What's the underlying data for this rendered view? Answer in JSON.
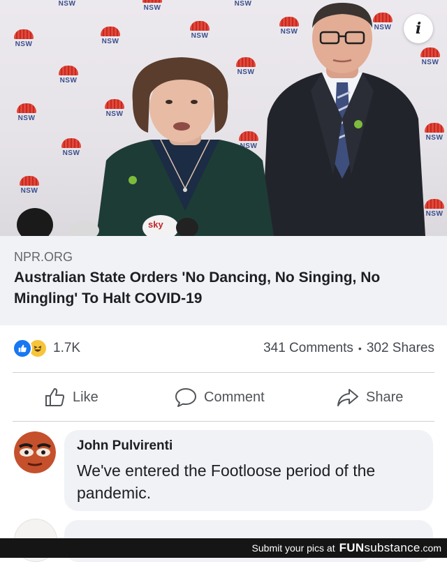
{
  "photo": {
    "logo_text": "NSW",
    "mic_label": "sky",
    "info_icon": "i"
  },
  "link_preview": {
    "domain": "NPR.ORG",
    "title": "Australian State Orders 'No Dancing, No Singing, No Mingling' To Halt COVID-19"
  },
  "reactions": {
    "icons": [
      "like-icon",
      "haha-icon"
    ],
    "count": "1.7K"
  },
  "stats": {
    "comments": "341 Comments",
    "separator": "•",
    "shares": "302 Shares"
  },
  "actions": {
    "like": "Like",
    "comment": "Comment",
    "share": "Share"
  },
  "comment": {
    "author": "John Pulvirenti",
    "text": "We've entered the Footloose period of the pandemic."
  },
  "watermark": {
    "prefix": "Submit your pics at",
    "brand_a": "FUN",
    "brand_b": "substance",
    "brand_c": ".com"
  },
  "colors": {
    "facebook_blue": "#1877f2",
    "haha_yellow": "#f7c53b",
    "text_primary": "#1c1e21",
    "text_secondary": "#65676b",
    "nsw_red": "#c8281f",
    "nsw_blue": "#3b4e8c"
  }
}
